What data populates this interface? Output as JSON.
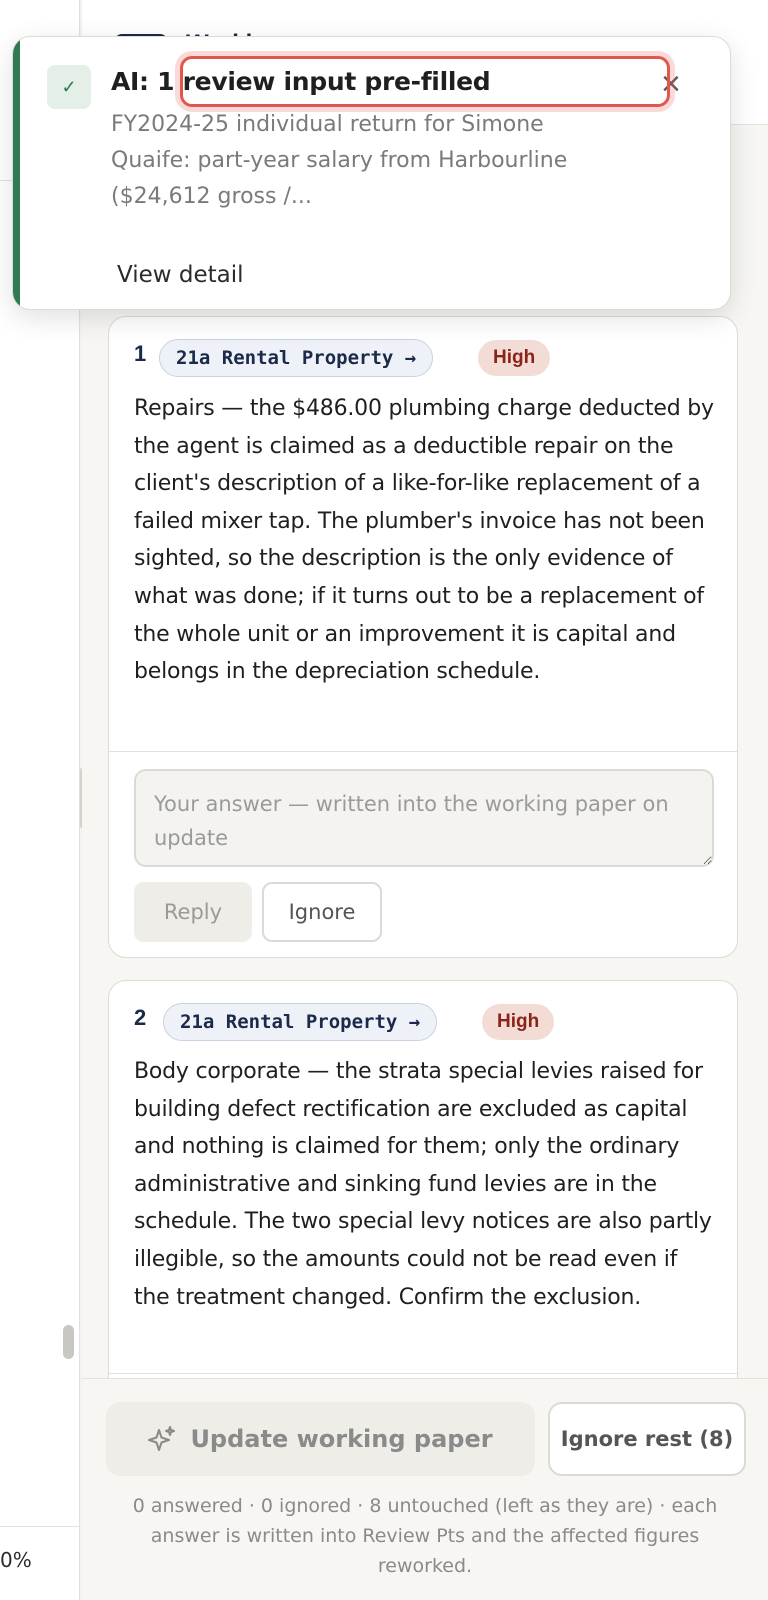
{
  "behind": {
    "header_title": "Working paper",
    "left_value": "0%"
  },
  "toast": {
    "title": "AI: 1 review input pre-filled",
    "body": "FY2024-25 individual return for Simone Quaife: part-year salary from Harbourline ($24,612 gross /...",
    "detail_label": "View detail",
    "close_glyph": "×",
    "check_glyph": "✓"
  },
  "items": [
    {
      "number": "1",
      "tag": "21a Rental Property →",
      "priority": "High",
      "text": "Repairs — the $486.00 plumbing charge deducted by the agent is claimed as a deductible repair on the client's description of a like-for-like replacement of a failed mixer tap. The plumber's invoice has not been sighted, so the description is the only evidence of what was done; if it turns out to be a replacement of the whole unit or an improvement it is capital and belongs in the depreciation schedule.",
      "answer_placeholder": "Your answer — written into the working paper on update",
      "reply_label": "Reply",
      "ignore_label": "Ignore"
    },
    {
      "number": "2",
      "tag": "21a Rental Property →",
      "priority": "High",
      "text": "Body corporate — the strata special levies raised for building defect rectification are excluded as capital and nothing is claimed for them; only the ordinary administrative and sinking fund levies are in the schedule. The two special levy notices are also partly illegible, so the amounts could not be read even if the treatment changed. Confirm the exclusion."
    }
  ],
  "footer": {
    "update_label": "Update working paper",
    "ignore_rest_label": "Ignore rest (8)",
    "summary": "0 answered · 0 ignored · 8 untouched (left as they are) · each answer is written into Review Pts and the affected figures reworked."
  },
  "colors": {
    "accent_green": "#2f7a53",
    "focus_red": "#e2574c",
    "navy": "#1b2a4a",
    "high_badge_bg": "#f3dcd6",
    "high_badge_text": "#8a2418"
  }
}
